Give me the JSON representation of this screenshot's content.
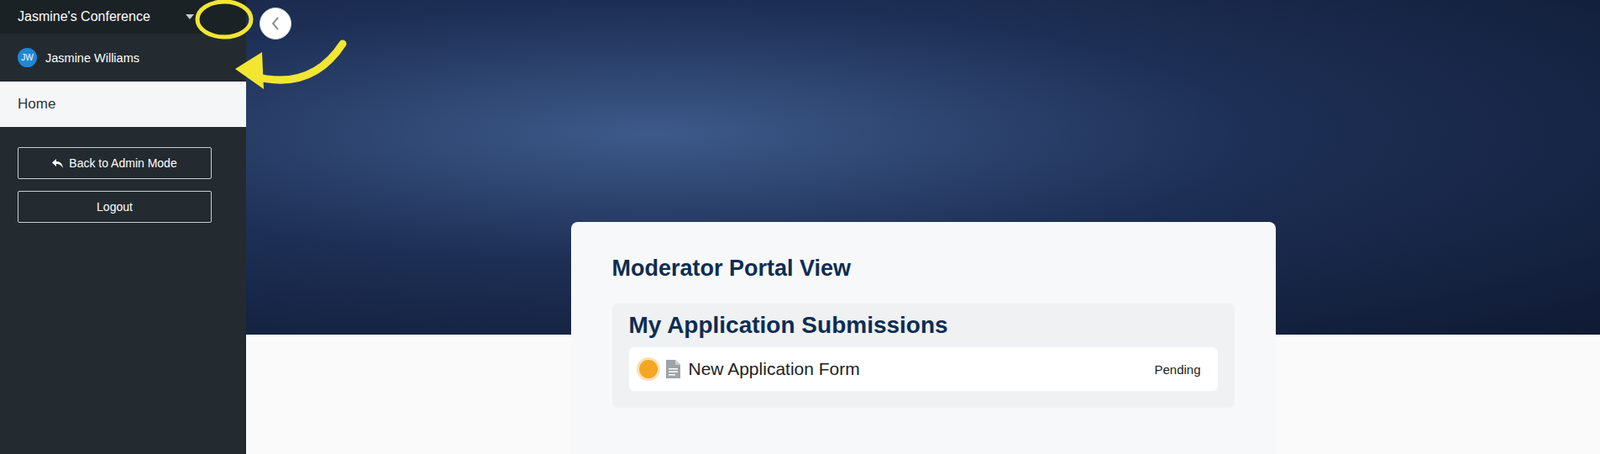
{
  "sidebar": {
    "event_title": "Jasmine's Conference",
    "user": {
      "initials": "JW",
      "name": "Jasmine Williams"
    },
    "nav": [
      {
        "label": "Home",
        "selected": true
      }
    ],
    "buttons": [
      "Back to Admin Mode",
      "Logout"
    ]
  },
  "main": {
    "title": "Moderator Portal View",
    "section": {
      "title": "My Application Submissions",
      "items": [
        {
          "name": "New Application Form",
          "status": "Pending",
          "color": "#f5a623"
        }
      ]
    }
  }
}
